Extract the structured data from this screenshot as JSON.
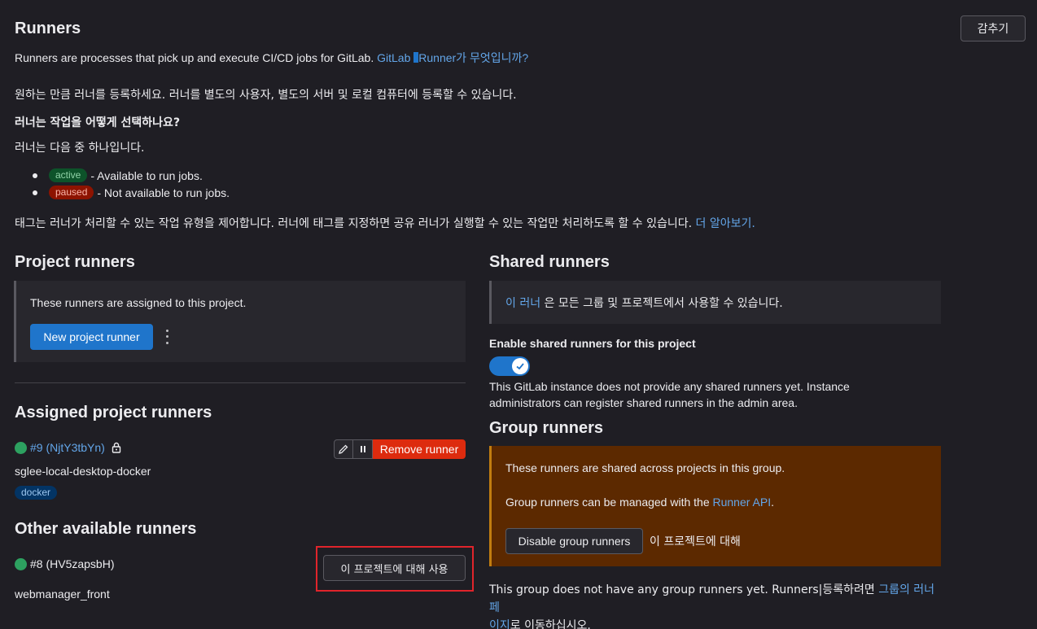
{
  "header": {
    "title": "Runners",
    "collapse_label": "감추기",
    "description": "Runners are processes that pick up and execute CI/CD jobs for GitLab.",
    "what_is_link_a": "GitLab ",
    "what_is_link_b": "Runner가 무엇입니까?"
  },
  "intro": {
    "register_text": "원하는 만큼 러너를 등록하세요. 러너를 별도의 사용자, 별도의 서버 및 로컬 컴퓨터에 등록할 수 있습니다.",
    "how_choose_heading": "러너는 작업을 어떻게 선택하나요?",
    "states_text": "러너는 다음 중 하나입니다.",
    "states": [
      {
        "badge": "active",
        "text": "- Available to run jobs."
      },
      {
        "badge": "paused",
        "text": "- Not available to run jobs."
      }
    ],
    "tags_text": "태그는 러너가 처리할 수 있는 작업 유형을 제어합니다. 러너에 태그를 지정하면 공유 러너가 실행할 수 있는 작업만 처리하도록 할 수 있습니다.",
    "learn_more": "더 알아보기."
  },
  "project_runners": {
    "heading": "Project runners",
    "panel_text": "These runners are assigned to this project.",
    "new_button": "New project runner"
  },
  "assigned": {
    "heading": "Assigned project runners",
    "runner_id": "#9 (NjtY3tbYn)",
    "runner_name": "sglee-local-desktop-docker",
    "tag": "docker",
    "remove_button": "Remove runner"
  },
  "other": {
    "heading": "Other available runners",
    "runner_id": "#8 (HV5zapsbH)",
    "runner_name": "webmanager_front",
    "enable_button": "이 프로젝트에 대해 사용"
  },
  "shared": {
    "heading": "Shared runners",
    "panel_link": "이 러너",
    "panel_text": " 은 모든 그룹 및 프로젝트에서 사용할 수 있습니다.",
    "toggle_label": "Enable shared runners for this project",
    "toggle_on": true,
    "note": "This GitLab instance does not provide any shared runners yet. Instance administrators can register shared runners in the admin area."
  },
  "group": {
    "heading": "Group runners",
    "panel_text1": "These runners are shared across projects in this group.",
    "panel_text2": "Group runners can be managed with the ",
    "runner_api_link": "Runner API",
    "panel_text2_end": ".",
    "disable_button": "Disable group runners",
    "disable_suffix": "이 프로젝트에 대해",
    "footer_text_a": "This group does not have any group runners yet. Runners|등록하려면 ",
    "footer_link_a": "그룹의 러너 페",
    "footer_link_b": "이지",
    "footer_text_b": "로 이동하십시오."
  },
  "colors": {
    "background": "#1f1e24",
    "panel": "#28272d",
    "link": "#63a6e9",
    "primary": "#1f75cb",
    "danger": "#dd2b0e",
    "warning_panel": "#5c2900",
    "highlight_box": "#dd2b0e"
  }
}
